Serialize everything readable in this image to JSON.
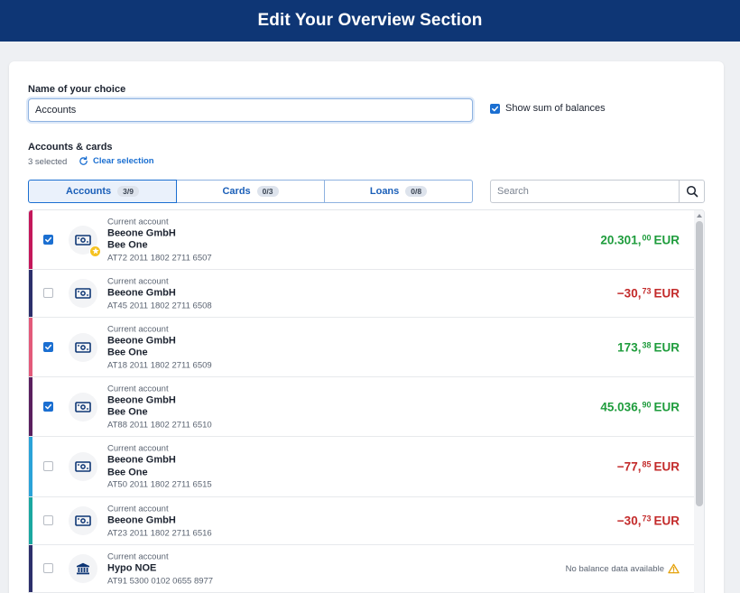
{
  "header": {
    "title": "Edit Your Overview Section"
  },
  "form": {
    "name_label": "Name of your choice",
    "name_value": "Accounts",
    "show_sum_label": "Show sum of balances",
    "show_sum_checked": true
  },
  "selection": {
    "section_label": "Accounts & cards",
    "selected_text": "3 selected",
    "clear_label": "Clear selection"
  },
  "tabs": [
    {
      "label": "Accounts",
      "badge": "3/9",
      "active": true
    },
    {
      "label": "Cards",
      "badge": "0/3",
      "active": false
    },
    {
      "label": "Loans",
      "badge": "0/8",
      "active": false
    }
  ],
  "search": {
    "placeholder": "Search"
  },
  "accounts": [
    {
      "type": "Current account",
      "owner": "Beeone GmbH",
      "product": "Bee One",
      "iban": "AT72 2011 1802 2711 6507",
      "amount_int": "20.301",
      "amount_dec": "00",
      "currency": "EUR",
      "sign": "pos",
      "checked": true,
      "favorite": true,
      "icon": "banknote-icon",
      "color": "#c4175a"
    },
    {
      "type": "Current account",
      "owner": "Beeone GmbH",
      "product": "",
      "iban": "AT45 2011 1802 2711 6508",
      "amount_int": "−30",
      "amount_dec": "73",
      "currency": "EUR",
      "sign": "neg",
      "checked": false,
      "favorite": false,
      "icon": "banknote-icon",
      "color": "#2c2f6b"
    },
    {
      "type": "Current account",
      "owner": "Beeone GmbH",
      "product": "Bee One",
      "iban": "AT18 2011 1802 2711 6509",
      "amount_int": "173",
      "amount_dec": "38",
      "currency": "EUR",
      "sign": "pos",
      "checked": true,
      "favorite": false,
      "icon": "banknote-icon",
      "color": "#e35a7a"
    },
    {
      "type": "Current account",
      "owner": "Beeone GmbH",
      "product": "Bee One",
      "iban": "AT88 2011 1802 2711 6510",
      "amount_int": "45.036",
      "amount_dec": "90",
      "currency": "EUR",
      "sign": "pos",
      "checked": true,
      "favorite": false,
      "icon": "banknote-icon",
      "color": "#5a1f5e"
    },
    {
      "type": "Current account",
      "owner": "Beeone GmbH",
      "product": "Bee One",
      "iban": "AT50 2011 1802 2711 6515",
      "amount_int": "−77",
      "amount_dec": "85",
      "currency": "EUR",
      "sign": "neg",
      "checked": false,
      "favorite": false,
      "icon": "banknote-icon",
      "color": "#2aa3d8"
    },
    {
      "type": "Current account",
      "owner": "Beeone GmbH",
      "product": "",
      "iban": "AT23 2011 1802 2711 6516",
      "amount_int": "−30",
      "amount_dec": "73",
      "currency": "EUR",
      "sign": "neg",
      "checked": false,
      "favorite": false,
      "icon": "banknote-icon",
      "color": "#1aa7a0"
    },
    {
      "type": "Current account",
      "owner": "Hypo NOE",
      "product": "",
      "iban": "AT91 5300 0102 0655 8977",
      "no_data": "No balance data available",
      "checked": false,
      "favorite": false,
      "icon": "bank-building-icon",
      "color": "#2c2f6b"
    }
  ]
}
